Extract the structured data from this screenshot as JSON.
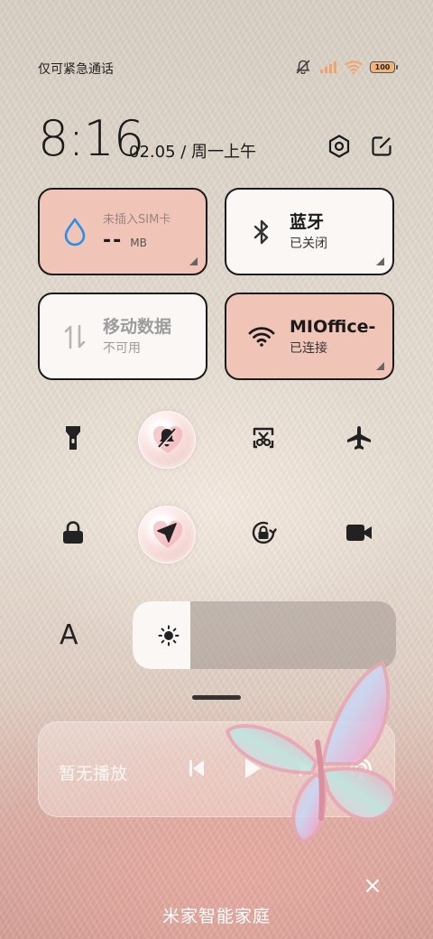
{
  "status_bar": {
    "carrier": "仅可紧急通话",
    "battery_level": "100",
    "icons": [
      "silent-icon",
      "signal-icon",
      "wifi-icon",
      "battery-icon"
    ]
  },
  "header": {
    "time": "8:16",
    "date": "02.05 / 周一上午",
    "settings_icon": "hexagon-gear-icon",
    "edit_icon": "edit-icon"
  },
  "tiles": {
    "data_usage": {
      "label": "未插入SIM卡",
      "value": "--",
      "unit": "MB",
      "icon": "water-drop-icon"
    },
    "bluetooth": {
      "title": "蓝牙",
      "status": "已关闭",
      "icon": "bluetooth-icon"
    },
    "mobile_data": {
      "title": "移动数据",
      "status": "不可用",
      "icon": "data-arrows-icon"
    },
    "wifi": {
      "title": "MIOffice-",
      "status": "已连接",
      "icon": "wifi-icon"
    }
  },
  "toggles": {
    "row1": [
      {
        "name": "flashlight",
        "icon": "flashlight-icon",
        "active": false
      },
      {
        "name": "mute",
        "icon": "bell-off-icon",
        "active": true
      },
      {
        "name": "screenshot",
        "icon": "scissors-icon",
        "active": false
      },
      {
        "name": "airplane",
        "icon": "airplane-icon",
        "active": false
      }
    ],
    "row2": [
      {
        "name": "lock",
        "icon": "lock-icon",
        "active": false
      },
      {
        "name": "location",
        "icon": "location-arrow-icon",
        "active": true
      },
      {
        "name": "rotation-lock",
        "icon": "rotation-lock-icon",
        "active": false
      },
      {
        "name": "screen-record",
        "icon": "video-camera-icon",
        "active": false
      }
    ]
  },
  "display": {
    "font_label": "A",
    "brightness_level": 0.22
  },
  "media": {
    "now_playing": "暂无播放",
    "controls": [
      "previous-icon",
      "play-icon",
      "next-icon",
      "cast-icon"
    ]
  },
  "footer": {
    "title": "米家智能家庭",
    "close_icon": "close-icon"
  },
  "colors": {
    "tile_active": "#f1c4b8",
    "tile_inactive": "#fbf7f5",
    "accent_blue": "#2a8fe6"
  }
}
